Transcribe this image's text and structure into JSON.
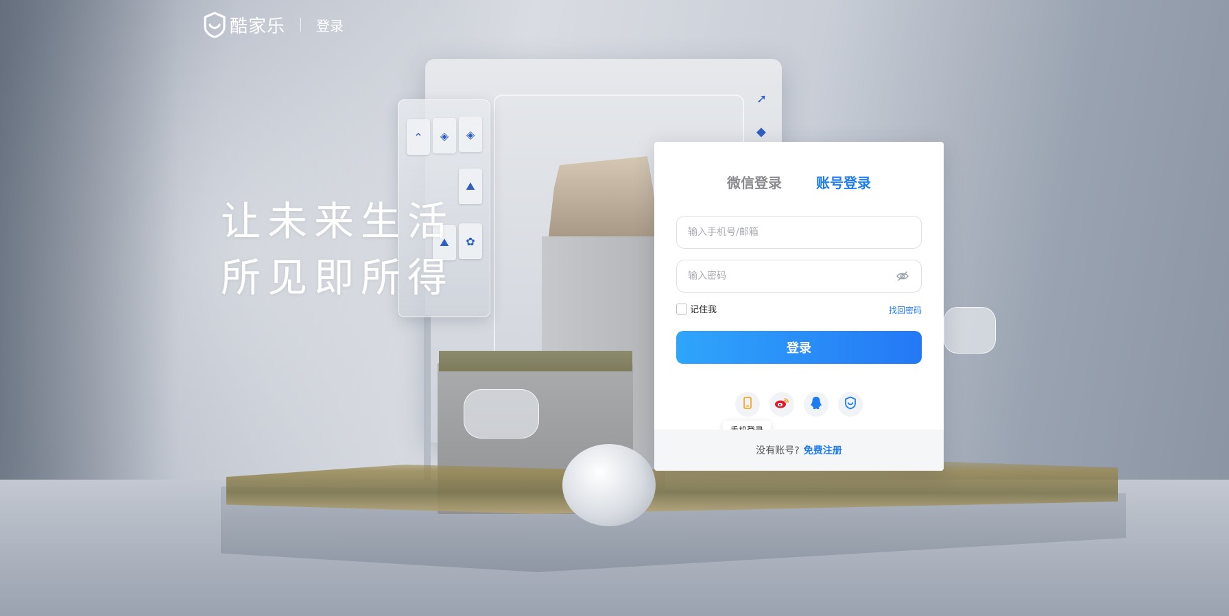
{
  "header": {
    "logo_text": "酷家乐",
    "title": "登录"
  },
  "slogan": {
    "line1": "让未来生活",
    "line2": "所见即所得"
  },
  "login": {
    "tabs": [
      {
        "label": "微信登录",
        "active": false
      },
      {
        "label": "账号登录",
        "active": true
      }
    ],
    "account_placeholder": "输入手机号/邮箱",
    "account_value": "",
    "password_placeholder": "输入密码",
    "password_value": "",
    "remember_label": "记住我",
    "remember_checked": false,
    "forgot_label": "找回密码",
    "submit_label": "登录",
    "social": [
      {
        "icon": "phone-icon",
        "color": "#f5a623"
      },
      {
        "icon": "weibo-icon",
        "color": "#e6162d"
      },
      {
        "icon": "qq-icon",
        "color": "#1e7cf0"
      },
      {
        "icon": "kujiale-icon",
        "color": "#1e7cf0"
      }
    ],
    "tooltip": "手机登录",
    "footer_text": "没有账号?",
    "register_label": "免费注册"
  },
  "colors": {
    "accent": "#1e7cf0",
    "button_gradient_start": "#2fa5fb",
    "button_gradient_end": "#2478f5"
  }
}
